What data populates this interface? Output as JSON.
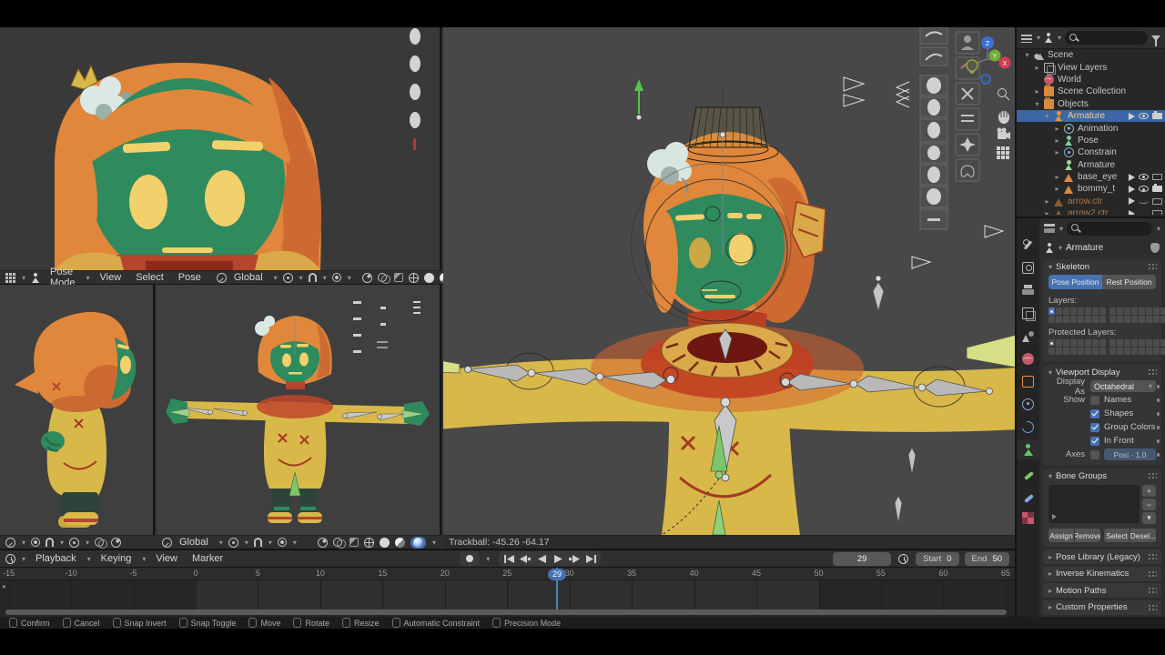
{
  "colors": {
    "accent_blue": "#4772b3",
    "selected_row_blue": "#3b67a4",
    "header_bg": "#2f2f2f",
    "viewport_bg_main": "#484848",
    "viewport_bg_side": "#3e3e3e",
    "face_green": "#2f8a5e",
    "hair_orange": "#e0873c",
    "hair_shadow": "#cd6a31",
    "sweater_yellow": "#d9b84a",
    "weight_paint_red": "#c23f22",
    "collar_dark_red": "#6e1710",
    "eye_yellow": "#f2d06b",
    "bone_gray": "#b9b9b9",
    "bone_green": "#7ec66a",
    "bone_yellow_green": "#d6de86"
  },
  "icons": {
    "search": "magnifier",
    "filter": "funnel",
    "snap": "magnet",
    "proportional_editing": "circle-dot",
    "nav_zoom": "magnifier",
    "nav_pan": "hand",
    "nav_camera": "camera",
    "nav_ortho": "grid",
    "record": "dot-circle"
  },
  "viewport_header": {
    "mode": "Pose Mode",
    "menu_view": "View",
    "menu_select": "Select",
    "menu_pose": "Pose",
    "orientation": "Global"
  },
  "subheader": {
    "orientation": "Global"
  },
  "main_status": "Trackball: -45.26 -64.17",
  "gizmo": {
    "x": "X",
    "y": "Y",
    "z": "Z"
  },
  "timeline": {
    "menu_playback": "Playback",
    "menu_keying": "Keying",
    "menu_view": "View",
    "menu_marker": "Marker",
    "ticks": [
      -15,
      -10,
      -5,
      0,
      5,
      10,
      15,
      20,
      25,
      30,
      35,
      40,
      45,
      50,
      55,
      60,
      65
    ],
    "current_frame": 29,
    "frame_field": "29",
    "start_label": "Start",
    "start_value": "0",
    "end_label": "End",
    "end_value": "50"
  },
  "outliner": {
    "items": [
      {
        "label": "Scene",
        "depth": 0,
        "icon": "scene",
        "caret": "open",
        "toggles": []
      },
      {
        "label": "View Layers",
        "depth": 1,
        "icon": "viewlayer",
        "caret": "closed",
        "toggles": []
      },
      {
        "label": "World",
        "depth": 1,
        "icon": "world",
        "caret": "none",
        "toggles": []
      },
      {
        "label": "Scene Collection",
        "depth": 1,
        "icon": "collection",
        "caret": "closed",
        "toggles": []
      },
      {
        "label": "Objects",
        "depth": 1,
        "icon": "collection",
        "caret": "open",
        "toggles": []
      },
      {
        "label": "Armature",
        "depth": 2,
        "icon": "armature",
        "caret": "open",
        "selected": true,
        "toggles": [
          "cursor",
          "eye",
          "camf"
        ]
      },
      {
        "label": "Animation",
        "depth": 3,
        "icon": "anim",
        "caret": "closed",
        "toggles": []
      },
      {
        "label": "Pose",
        "depth": 3,
        "icon": "pose",
        "caret": "closed",
        "toggles": []
      },
      {
        "label": "Constrain",
        "depth": 3,
        "icon": "constraint",
        "caret": "closed",
        "toggles": []
      },
      {
        "label": "Armature",
        "depth": 3,
        "icon": "armdata",
        "caret": "none",
        "toggles": []
      },
      {
        "label": "base_eye",
        "depth": 3,
        "icon": "mesh",
        "caret": "closed",
        "toggles": [
          "cursor",
          "eye",
          "camo"
        ]
      },
      {
        "label": "bommy_t",
        "depth": 3,
        "icon": "mesh",
        "caret": "closed",
        "toggles": [
          "cursor",
          "eye",
          "camf"
        ]
      },
      {
        "label": "arrow.ctr",
        "depth": 2,
        "icon": "mesh",
        "caret": "closed",
        "dim": true,
        "toggles": [
          "cursor",
          "eyeoff",
          "camo"
        ]
      },
      {
        "label": "arrow2.ctr",
        "depth": 2,
        "icon": "mesh",
        "caret": "closed",
        "dim": true,
        "toggles": [
          "cursor",
          "eyeoff",
          "camo"
        ]
      }
    ]
  },
  "properties": {
    "tabs": [
      "tool",
      "render",
      "output",
      "viewlayer",
      "scene",
      "world",
      "object",
      "constraints",
      "physics",
      "data",
      "bone",
      "boneconstraint",
      "texture"
    ],
    "active_tab": "data",
    "breadcrumb": "Armature",
    "skeleton": {
      "title": "Skeleton",
      "pose_position": "Pose Position",
      "rest_position": "Rest Position",
      "layers_label": "Layers:",
      "protected_label": "Protected Layers:"
    },
    "viewport_display": {
      "title": "Viewport Display",
      "display_as_label": "Display As",
      "display_as_value": "Octahedral",
      "show_label": "Show",
      "checkboxes": [
        {
          "label": "Names",
          "checked": false
        },
        {
          "label": "Shapes",
          "checked": true
        },
        {
          "label": "Group Colors",
          "checked": true
        },
        {
          "label": "In Front",
          "checked": true
        }
      ],
      "axes_label": "Axes",
      "axes_value": "Posi · 1.0"
    },
    "bone_groups": {
      "title": "Bone Groups",
      "assign": "Assign",
      "remove": "Remove",
      "select": "Select",
      "deselect": "Desel...",
      "add_label": "+",
      "remove_item_label": "−",
      "menu_label": "▾"
    },
    "collapsed_panels": [
      "Pose Library (Legacy)",
      "Inverse Kinematics",
      "Motion Paths",
      "Custom Properties"
    ]
  },
  "keymap_bar": {
    "items": [
      "Confirm",
      "Cancel",
      "Snap Invert",
      "Snap Toggle",
      "Move",
      "Rotate",
      "Resize",
      "Automatic Constraint",
      "Precision Mode"
    ]
  }
}
